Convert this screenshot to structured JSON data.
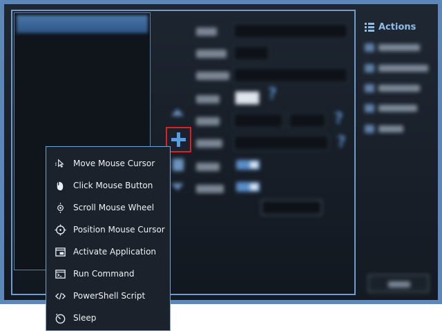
{
  "actions_panel": {
    "title": "Actions",
    "title_icon": "list-icon"
  },
  "add_action_button": {
    "icon": "plus-icon"
  },
  "menu": {
    "items": [
      {
        "label": "Move Mouse Cursor",
        "icon": "cursor-move-icon"
      },
      {
        "label": "Click Mouse Button",
        "icon": "mouse-click-icon"
      },
      {
        "label": "Scroll Mouse Wheel",
        "icon": "scroll-wheel-icon"
      },
      {
        "label": "Position Mouse Cursor",
        "icon": "crosshair-icon"
      },
      {
        "label": "Activate Application",
        "icon": "window-icon"
      },
      {
        "label": "Run Command",
        "icon": "terminal-icon"
      },
      {
        "label": "PowerShell Script",
        "icon": "code-icon"
      },
      {
        "label": "Sleep",
        "icon": "timer-icon"
      }
    ]
  },
  "colors": {
    "frame": "#5d87b8",
    "window_bg": "#1a212b",
    "accent": "#5b9be0",
    "highlight_border": "#e02020",
    "menu_bg": "#1b222c"
  }
}
